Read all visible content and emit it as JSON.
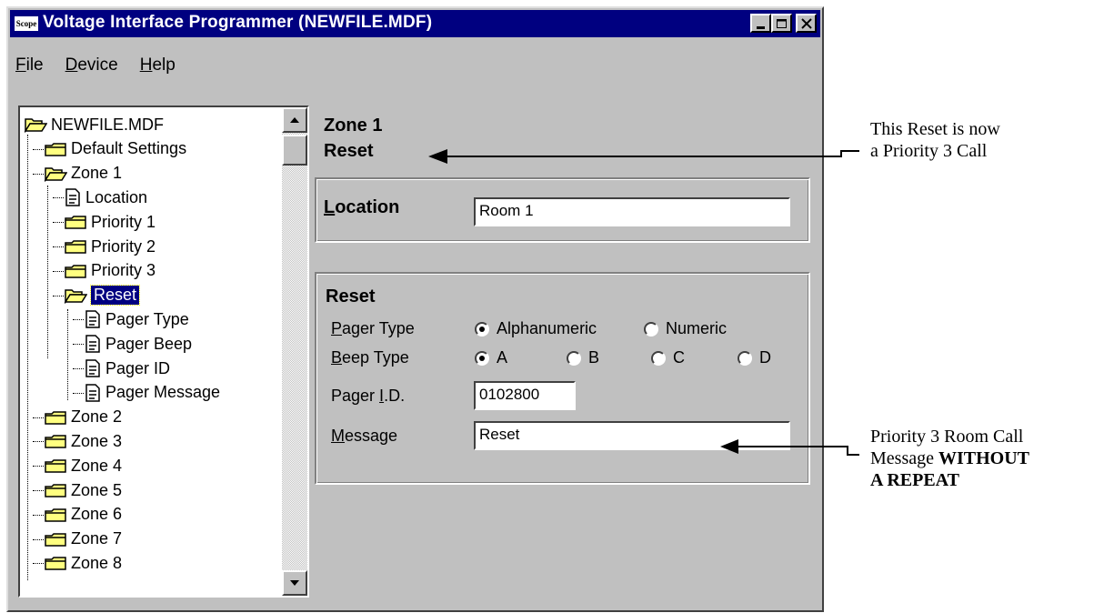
{
  "window": {
    "title": "Voltage Interface Programmer (NEWFILE.MDF)",
    "app_icon_text": "Scope"
  },
  "menu": {
    "file": {
      "key": "F",
      "rest": "ile"
    },
    "device": {
      "key": "D",
      "rest": "evice"
    },
    "help": {
      "key": "H",
      "rest": "elp"
    }
  },
  "tree": {
    "items": [
      {
        "label": "NEWFILE.MDF",
        "icon": "open-folder-icon"
      },
      {
        "label": "Default Settings",
        "icon": "folder-icon"
      },
      {
        "label": "Zone 1",
        "icon": "open-folder-icon"
      },
      {
        "label": "Location",
        "icon": "document-icon"
      },
      {
        "label": "Priority 1",
        "icon": "folder-icon"
      },
      {
        "label": "Priority 2",
        "icon": "folder-icon"
      },
      {
        "label": "Priority 3",
        "icon": "folder-icon"
      },
      {
        "label": "Reset",
        "icon": "open-folder-icon",
        "selected": true
      },
      {
        "label": "Pager Type",
        "icon": "document-icon"
      },
      {
        "label": "Pager Beep",
        "icon": "document-icon"
      },
      {
        "label": "Pager ID",
        "icon": "document-icon"
      },
      {
        "label": "Pager Message",
        "icon": "document-icon"
      },
      {
        "label": "Zone 2",
        "icon": "folder-icon"
      },
      {
        "label": "Zone 3",
        "icon": "folder-icon"
      },
      {
        "label": "Zone 4",
        "icon": "folder-icon"
      },
      {
        "label": "Zone 5",
        "icon": "folder-icon"
      },
      {
        "label": "Zone 6",
        "icon": "folder-icon"
      },
      {
        "label": "Zone 7",
        "icon": "folder-icon"
      },
      {
        "label": "Zone 8",
        "icon": "folder-icon"
      }
    ]
  },
  "detail": {
    "zone_heading": "Zone 1",
    "section_heading": "Reset",
    "location": {
      "key": "L",
      "rest": "ocation",
      "value": "Room 1"
    },
    "reset_group": {
      "title": "Reset",
      "pager_type": {
        "key": "P",
        "rest": "ager Type",
        "options": [
          "Alphanumeric",
          "Numeric"
        ],
        "selected": "Alphanumeric"
      },
      "beep_type": {
        "key": "B",
        "rest": "eep Type",
        "options": [
          "A",
          "B",
          "C",
          "D"
        ],
        "selected": "A"
      },
      "pager_id": {
        "pre": "Pager ",
        "key": "I",
        "rest": ".D.",
        "value": "0102800"
      },
      "message": {
        "key": "M",
        "rest": "essage",
        "value": "Reset"
      }
    }
  },
  "annotations": {
    "top": {
      "line1": "This Reset is now",
      "line2": "a Priority 3 Call"
    },
    "bottom": {
      "line1": "Priority 3 Room Call",
      "line2_plain": "Message ",
      "line2_bold": "WITHOUT",
      "line3_bold": "A REPEAT"
    }
  },
  "colors": {
    "titlebar": "#000080",
    "window": "#c0c0c0",
    "selection": "#000080"
  }
}
